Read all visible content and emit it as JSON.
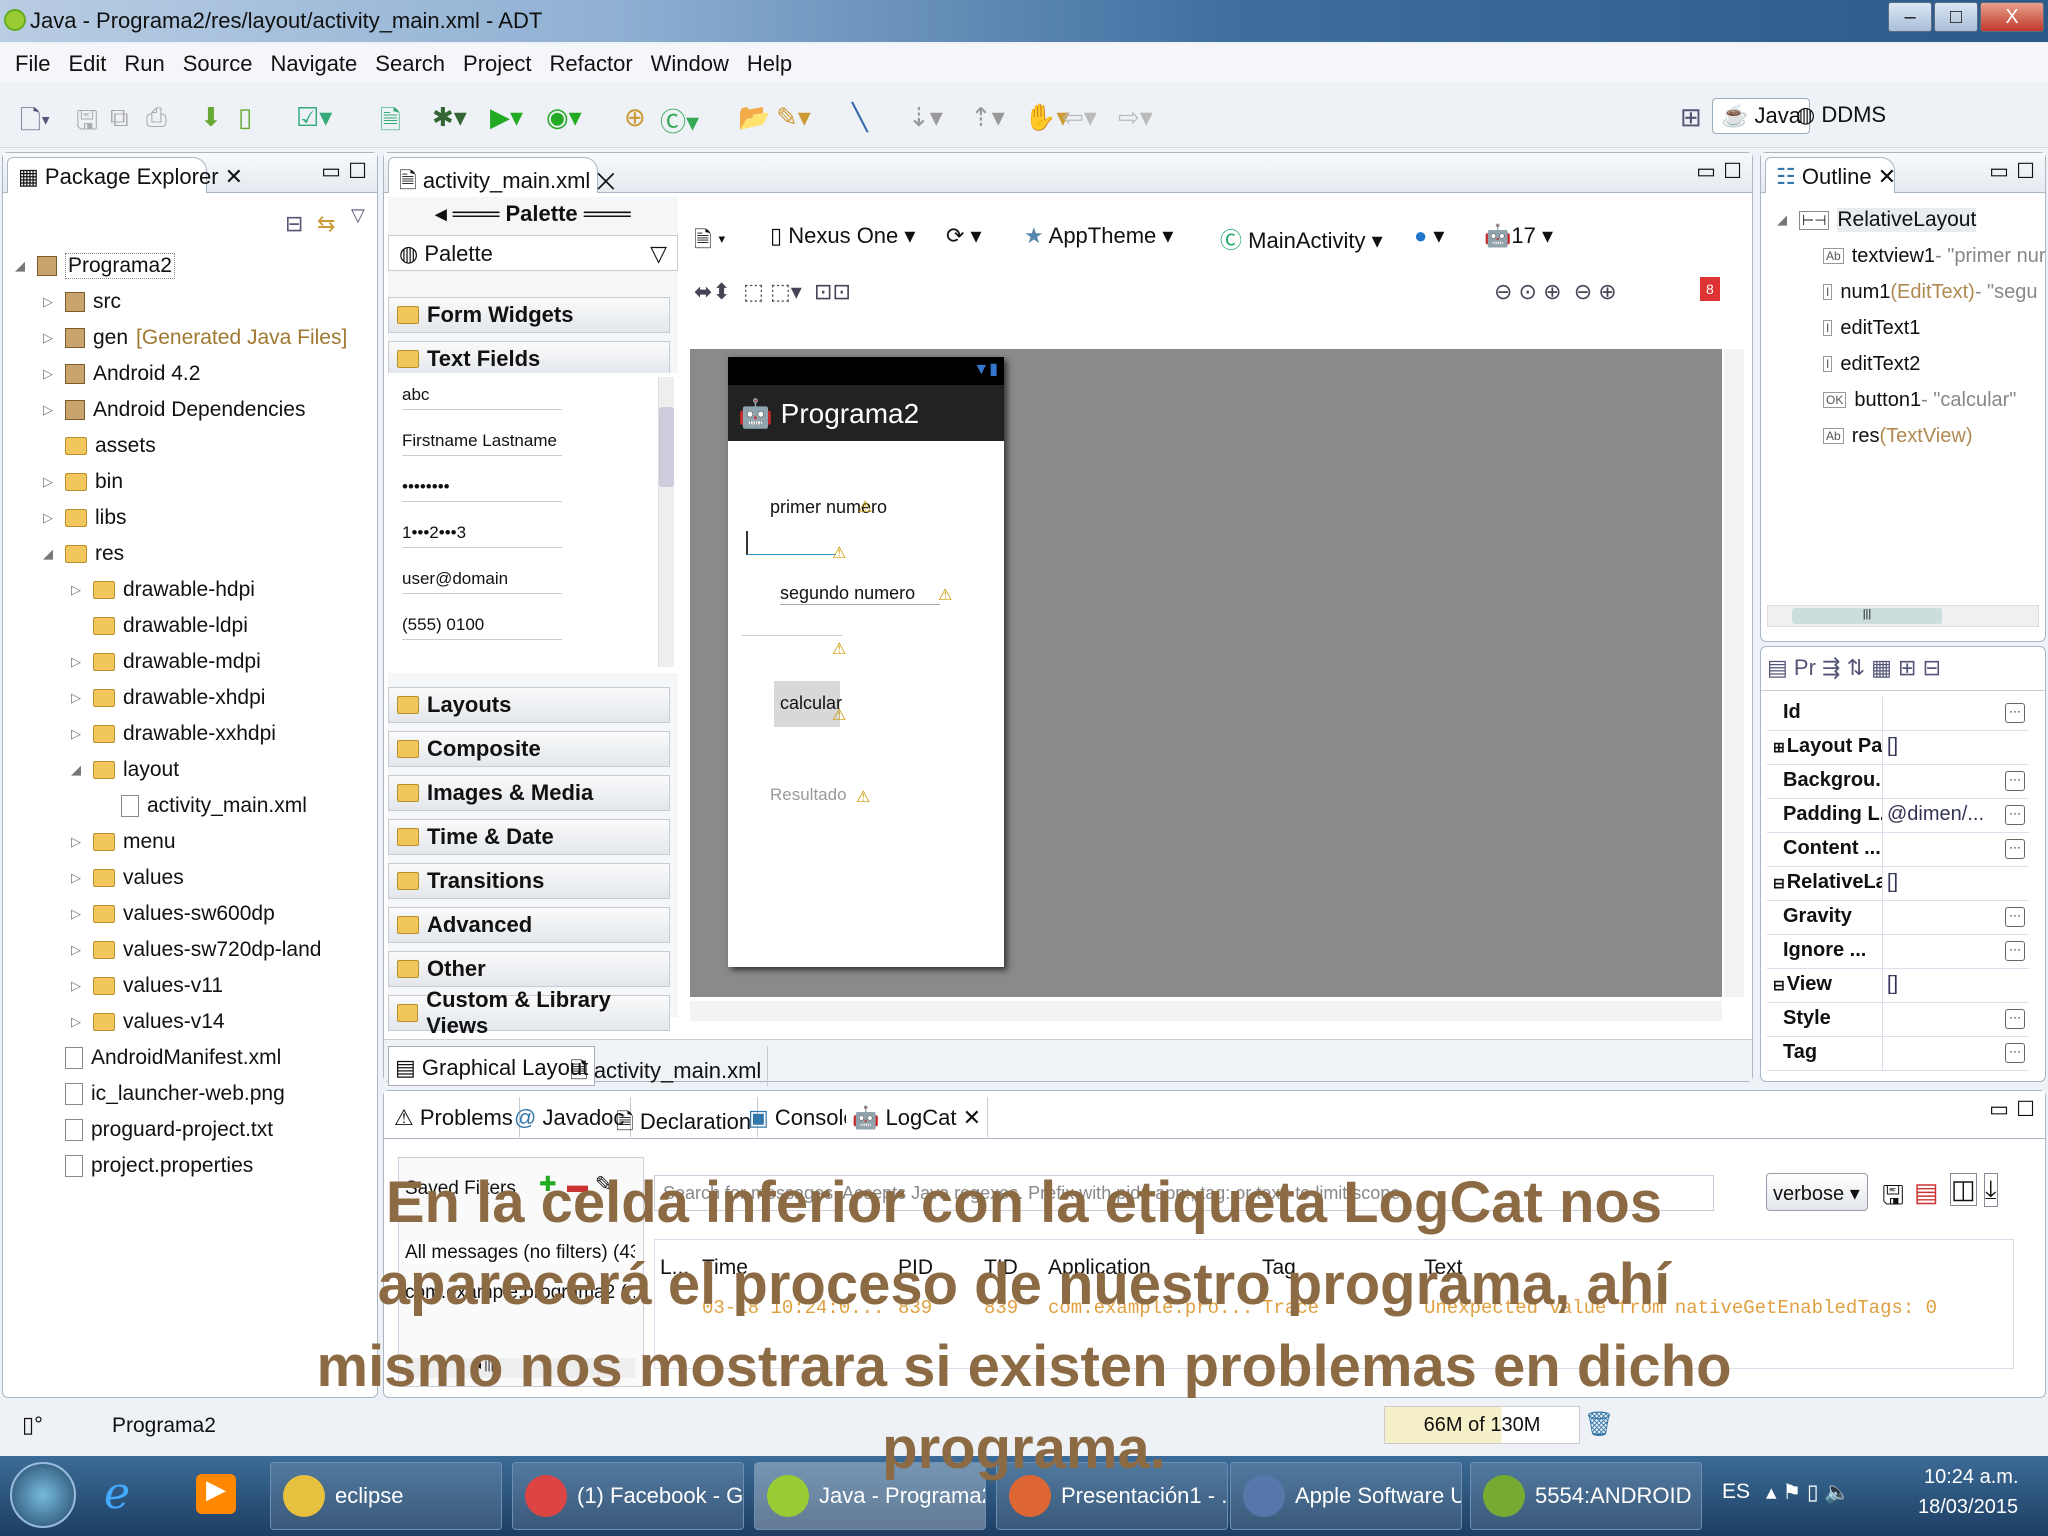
{
  "window": {
    "title": "Java - Programa2/res/layout/activity_main.xml - ADT",
    "min": "–",
    "max": "□",
    "close": "X"
  },
  "menu": [
    "File",
    "Edit",
    "Run",
    "Source",
    "Navigate",
    "Search",
    "Project",
    "Refactor",
    "Window",
    "Help"
  ],
  "perspectives": {
    "java": "Java",
    "ddms": "DDMS"
  },
  "package_explorer": {
    "title": "Package Explorer",
    "items": [
      {
        "label": "Programa2",
        "level": 0,
        "kind": "project",
        "exp": "◢"
      },
      {
        "label": "src",
        "level": 1,
        "kind": "pkg",
        "exp": "▷"
      },
      {
        "label": "gen",
        "suffix": "[Generated Java Files]",
        "level": 1,
        "kind": "pkg",
        "exp": "▷"
      },
      {
        "label": "Android 4.2",
        "level": 1,
        "kind": "lib",
        "exp": "▷"
      },
      {
        "label": "Android Dependencies",
        "level": 1,
        "kind": "lib",
        "exp": "▷"
      },
      {
        "label": "assets",
        "level": 1,
        "kind": "folder",
        "exp": ""
      },
      {
        "label": "bin",
        "level": 1,
        "kind": "folder",
        "exp": "▷"
      },
      {
        "label": "libs",
        "level": 1,
        "kind": "folder",
        "exp": "▷"
      },
      {
        "label": "res",
        "level": 1,
        "kind": "folder",
        "exp": "◢"
      },
      {
        "label": "drawable-hdpi",
        "level": 2,
        "kind": "folder",
        "exp": "▷"
      },
      {
        "label": "drawable-ldpi",
        "level": 2,
        "kind": "folder",
        "exp": ""
      },
      {
        "label": "drawable-mdpi",
        "level": 2,
        "kind": "folder",
        "exp": "▷"
      },
      {
        "label": "drawable-xhdpi",
        "level": 2,
        "kind": "folder",
        "exp": "▷"
      },
      {
        "label": "drawable-xxhdpi",
        "level": 2,
        "kind": "folder",
        "exp": "▷"
      },
      {
        "label": "layout",
        "level": 2,
        "kind": "folder",
        "exp": "◢"
      },
      {
        "label": "activity_main.xml",
        "level": 3,
        "kind": "file",
        "exp": ""
      },
      {
        "label": "menu",
        "level": 2,
        "kind": "folder",
        "exp": "▷"
      },
      {
        "label": "values",
        "level": 2,
        "kind": "folder",
        "exp": "▷"
      },
      {
        "label": "values-sw600dp",
        "level": 2,
        "kind": "folder",
        "exp": "▷"
      },
      {
        "label": "values-sw720dp-land",
        "level": 2,
        "kind": "folder",
        "exp": "▷"
      },
      {
        "label": "values-v11",
        "level": 2,
        "kind": "folder",
        "exp": "▷"
      },
      {
        "label": "values-v14",
        "level": 2,
        "kind": "folder",
        "exp": "▷"
      },
      {
        "label": "AndroidManifest.xml",
        "level": 1,
        "kind": "file",
        "exp": ""
      },
      {
        "label": "ic_launcher-web.png",
        "level": 1,
        "kind": "file",
        "exp": ""
      },
      {
        "label": "proguard-project.txt",
        "level": 1,
        "kind": "file",
        "exp": ""
      },
      {
        "label": "project.properties",
        "level": 1,
        "kind": "file",
        "exp": ""
      }
    ]
  },
  "editor": {
    "tab": "activity_main.xml",
    "palette": {
      "header": "Palette",
      "dropdown": "Palette",
      "top_categories": [
        "Form Widgets",
        "Text Fields"
      ],
      "fields": [
        "abc",
        "Firstname Lastname",
        "••••••••",
        "1•••2•••3",
        "user@domain",
        "(555) 0100"
      ],
      "categories": [
        "Layouts",
        "Composite",
        "Images & Media",
        "Time & Date",
        "Transitions",
        "Advanced",
        "Other",
        "Custom & Library Views"
      ]
    },
    "toolbar": {
      "device": "Nexus One",
      "theme": "AppTheme",
      "activity": "MainActivity",
      "api": "17",
      "error_count": "8"
    },
    "phone": {
      "app_title": "Programa2",
      "label1": "primer numero",
      "label2": "segundo numero",
      "button": "calcular",
      "result": "Resultado"
    },
    "bottom_tabs": [
      "Graphical Layout",
      "activity_main.xml"
    ]
  },
  "outline": {
    "title": "Outline",
    "root": "RelativeLayout",
    "items": [
      {
        "name": "textview1",
        "detail": " - \"primer nur",
        "icon": "Ab"
      },
      {
        "name": "num1",
        "type": " (EditText)",
        "detail": " - \"segu",
        "icon": "I"
      },
      {
        "name": "editText1",
        "icon": "I"
      },
      {
        "name": "editText2",
        "icon": "I"
      },
      {
        "name": "button1",
        "detail": " - \"calcular\"",
        "icon": "OK"
      },
      {
        "name": "res",
        "type": " (TextView)",
        "icon": "Ab"
      }
    ]
  },
  "properties": {
    "title": "Pr",
    "rows": [
      {
        "k": "Id",
        "v": ""
      },
      {
        "k": "Layout Pa...",
        "v": "[]",
        "exp": "⊞"
      },
      {
        "k": "Backgrou...",
        "v": ""
      },
      {
        "k": "Padding L...",
        "v": "@dimen/..."
      },
      {
        "k": "Content ...",
        "v": ""
      },
      {
        "k": "RelativeLa...",
        "v": "[]",
        "exp": "⊟"
      },
      {
        "k": "Gravity",
        "v": ""
      },
      {
        "k": "Ignore ...",
        "v": ""
      },
      {
        "k": "View",
        "v": "[]",
        "exp": "⊟"
      },
      {
        "k": "Style",
        "v": ""
      },
      {
        "k": "Tag",
        "v": ""
      }
    ]
  },
  "bottom": {
    "tabs": [
      "Problems",
      "Javadoc",
      "Declaration",
      "Console",
      "LogCat"
    ],
    "saved_filters": "Saved Filters",
    "filters": [
      "All messages (no filters) (43",
      "com.example.programa2 (..."
    ],
    "search_placeholder": "Search for messages. Accepts Java regexes. Prefix with pid:, app:, tag: or text: to limit scope.",
    "level": "verbose",
    "columns": [
      "L...",
      "Time",
      "PID",
      "TID",
      "Application",
      "Tag",
      "Text"
    ],
    "rows": [
      [
        "",
        "03-18 10:24:0...",
        "839",
        "839",
        "com.example.pro...",
        "Trace",
        "Unexpected value from nativeGetEnabledTags: 0"
      ]
    ]
  },
  "status": {
    "selection": "Programa2",
    "memory": "66M of 130M"
  },
  "overlay": {
    "lines": [
      "En la celda inferior con la etiqueta LogCat nos",
      "aparecerá el proceso de nuestro programa, ahí",
      "mismo nos mostrara si existen problemas en dicho",
      "programa."
    ]
  },
  "taskbar": {
    "items": [
      "eclipse",
      "(1) Facebook - G...",
      "Java - Programa2...",
      "Presentación1 - ...",
      "Apple Software U...",
      "5554:ANDROID"
    ],
    "lang": "ES",
    "time": "10:24 a.m.",
    "date": "18/03/2015"
  }
}
